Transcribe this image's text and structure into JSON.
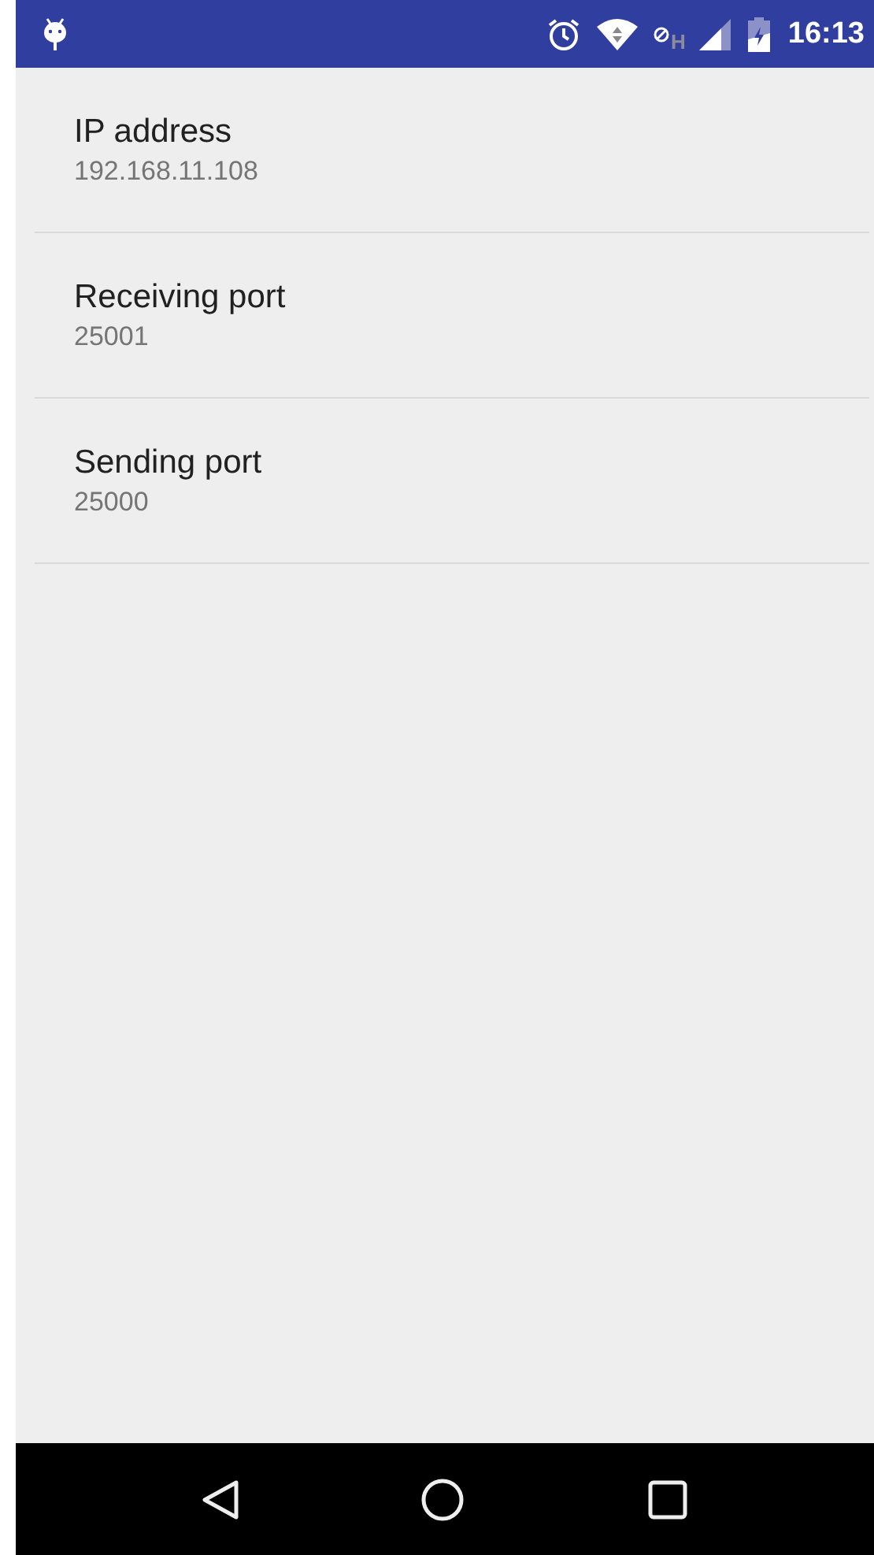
{
  "status_bar": {
    "network_type": "H",
    "time": "16:13"
  },
  "preferences": [
    {
      "title": "IP address",
      "summary": "192.168.11.108"
    },
    {
      "title": "Receiving port",
      "summary": "25001"
    },
    {
      "title": "Sending port",
      "summary": "25000"
    }
  ]
}
